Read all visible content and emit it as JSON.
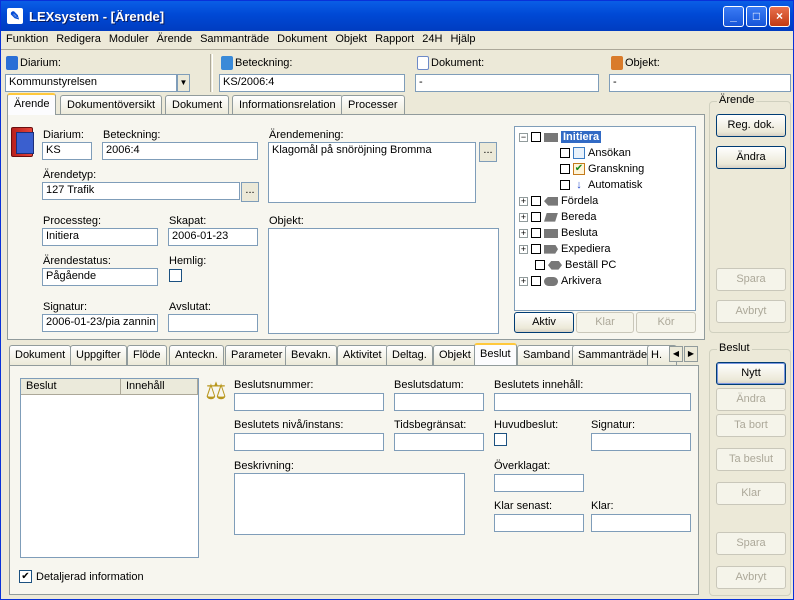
{
  "window": {
    "title": "LEXsystem - [Ärende]",
    "min": "_",
    "max": "□",
    "close": "×"
  },
  "menu": [
    "Funktion",
    "Redigera",
    "Moduler",
    "Ärende",
    "Sammanträde",
    "Dokument",
    "Objekt",
    "Rapport",
    "24H",
    "Hjälp"
  ],
  "toolbar": {
    "diarium_label": "Diarium:",
    "diarium_value": "Kommunstyrelsen",
    "beteckning_label": "Beteckning:",
    "beteckning_value": "KS/2006:4",
    "dokument_label": "Dokument:",
    "dokument_value": "-",
    "objekt_label": "Objekt:",
    "objekt_value": "-"
  },
  "top_tabs": [
    "Ärende",
    "Dokumentöversikt",
    "Dokument",
    "Informationsrelation",
    "Processer"
  ],
  "form": {
    "diarium_label": "Diarium:",
    "diarium": "KS",
    "beteckning_label": "Beteckning:",
    "beteckning": "2006:4",
    "arendemening_label": "Ärendemening:",
    "arendemening": "Klagomål på snöröjning Bromma",
    "arendetyp_label": "Ärendetyp:",
    "arendetyp": "127 Trafik",
    "objekt_label": "Objekt:",
    "processteg_label": "Processteg:",
    "processteg": "Initiera",
    "skapat_label": "Skapat:",
    "skapat": "2006-01-23",
    "arendestatus_label": "Ärendestatus:",
    "arendestatus": "Pågående",
    "hemlig_label": "Hemlig:",
    "signatur_label": "Signatur:",
    "signatur": "2006-01-23/pia zannin",
    "avslutat_label": "Avslutat:",
    "dots": "..."
  },
  "process_tree": {
    "nodes": [
      "Initiera",
      "Ansökan",
      "Granskning",
      "Automatisk",
      "Fördela",
      "Bereda",
      "Besluta",
      "Expediera",
      "Beställ PC",
      "Arkivera"
    ],
    "buttons": [
      "Aktiv",
      "Klar",
      "Kör"
    ]
  },
  "arende_group": {
    "title": "Ärende",
    "buttons": [
      "Reg. dok.",
      "Ändra",
      "Spara",
      "Avbryt"
    ]
  },
  "bottom_tabs": [
    "Dokument",
    "Uppgifter",
    "Flöde",
    "Anteckn.",
    "Parameter",
    "Bevakn.",
    "Aktivitet",
    "Deltag.",
    "Objekt",
    "Beslut",
    "Samband",
    "Sammanträde",
    "H."
  ],
  "scroll_arrows": [
    "◀",
    "▶"
  ],
  "beslut_list": {
    "columns": [
      "Beslut",
      "Innehåll"
    ]
  },
  "beslut_form": {
    "beslutsnummer": "Beslutsnummer:",
    "beslutsdatum": "Beslutsdatum:",
    "innehall": "Beslutets innehåll:",
    "niva": "Beslutets nivå/instans:",
    "tidsbegransat": "Tidsbegränsat:",
    "huvudbeslut": "Huvudbeslut:",
    "signatur": "Signatur:",
    "beskrivning": "Beskrivning:",
    "overklagat": "Överklagat:",
    "klar_senast": "Klar senast:",
    "klar": "Klar:"
  },
  "detaljerad": "Detaljerad information",
  "beslut_group": {
    "title": "Beslut",
    "buttons": [
      "Nytt",
      "Ändra",
      "Ta bort",
      "Ta beslut",
      "Klar",
      "Spara",
      "Avbryt"
    ]
  }
}
